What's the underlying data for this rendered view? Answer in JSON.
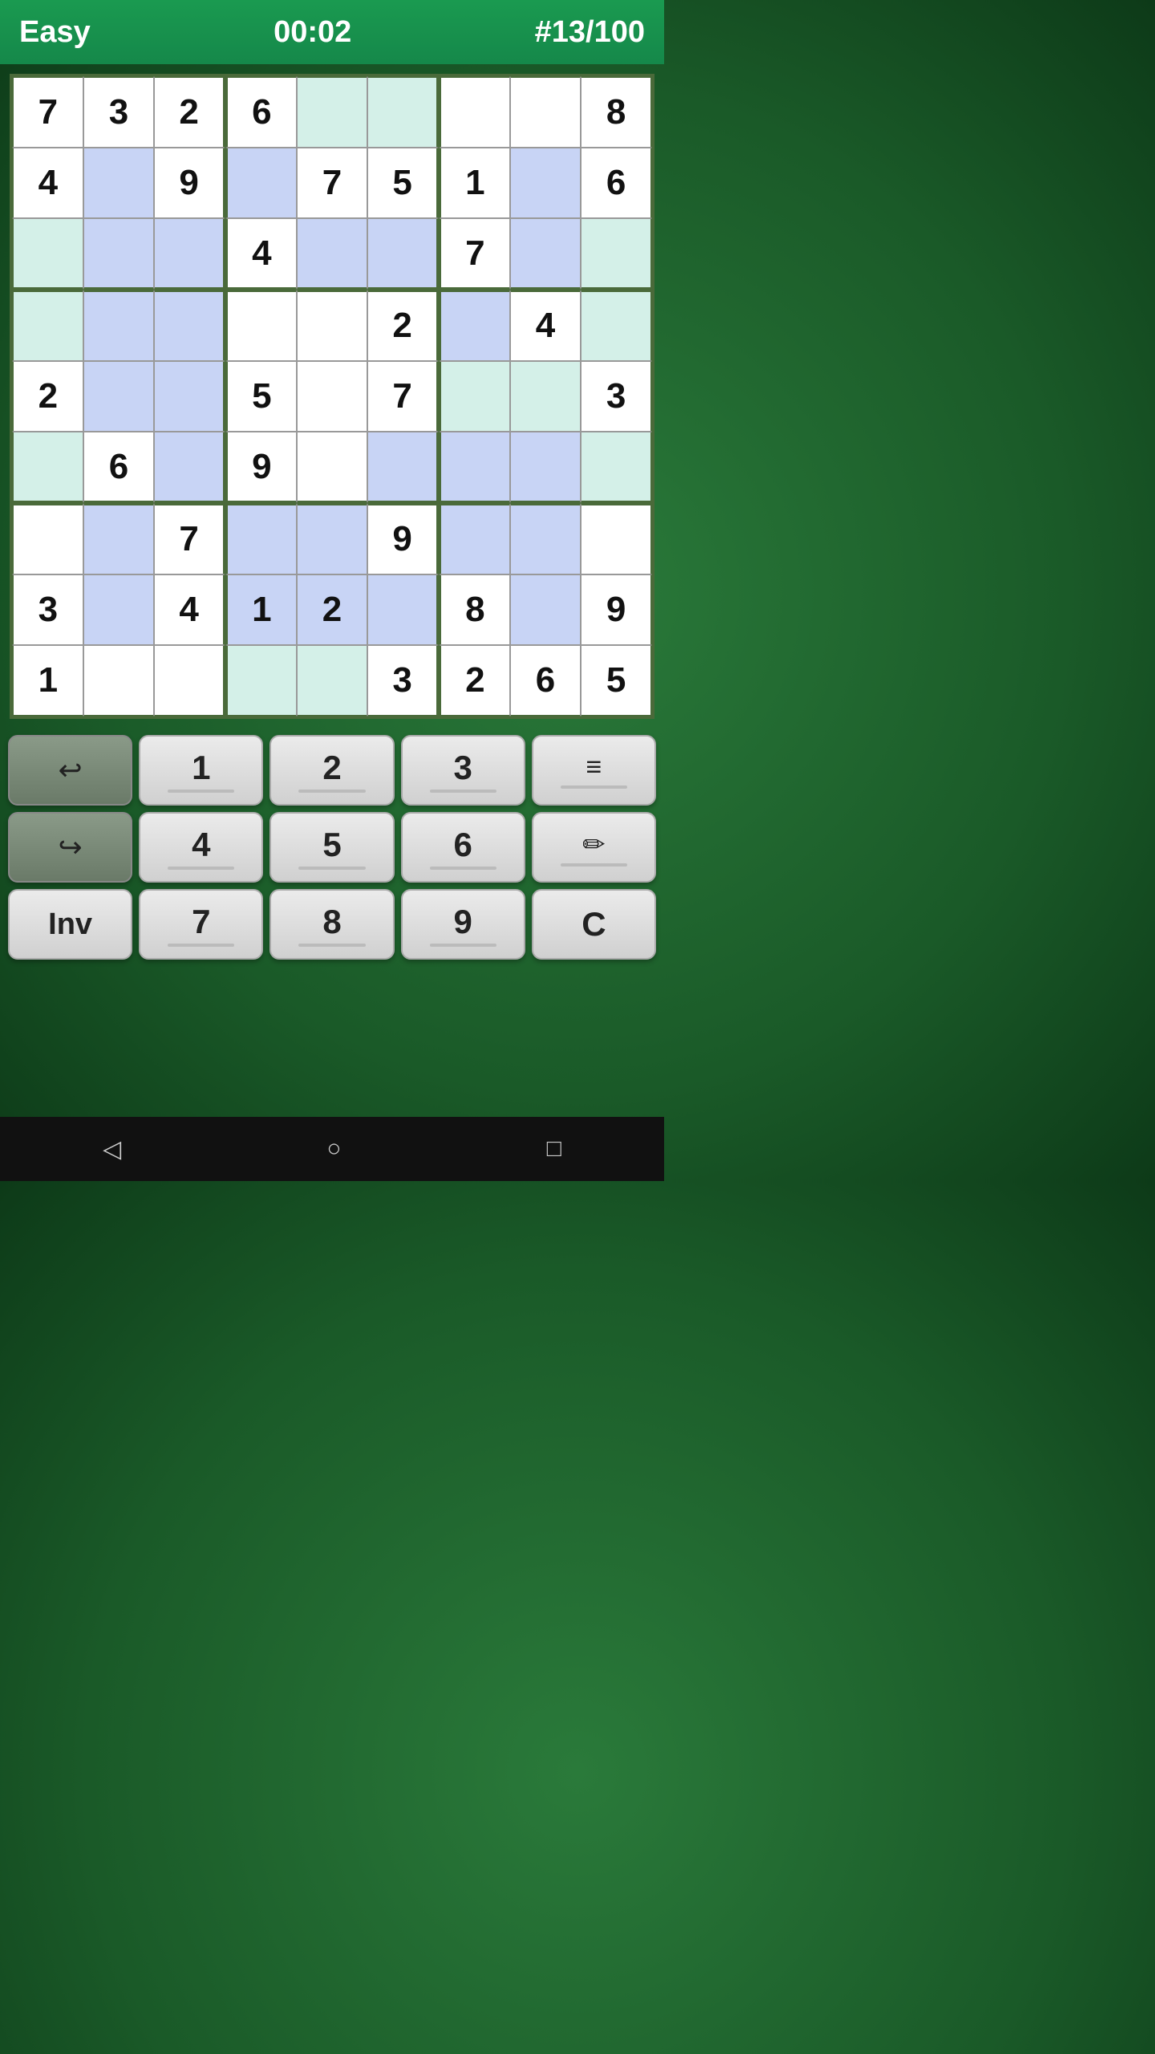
{
  "header": {
    "difficulty": "Easy",
    "timer": "00:02",
    "puzzle_id": "#13/100"
  },
  "grid": {
    "cells": [
      {
        "row": 0,
        "col": 0,
        "value": "7",
        "bg": "white"
      },
      {
        "row": 0,
        "col": 1,
        "value": "3",
        "bg": "white"
      },
      {
        "row": 0,
        "col": 2,
        "value": "2",
        "bg": "white"
      },
      {
        "row": 0,
        "col": 3,
        "value": "6",
        "bg": "white"
      },
      {
        "row": 0,
        "col": 4,
        "value": "",
        "bg": "light-teal"
      },
      {
        "row": 0,
        "col": 5,
        "value": "",
        "bg": "light-teal"
      },
      {
        "row": 0,
        "col": 6,
        "value": "",
        "bg": "white"
      },
      {
        "row": 0,
        "col": 7,
        "value": "",
        "bg": "white"
      },
      {
        "row": 0,
        "col": 8,
        "value": "8",
        "bg": "white"
      },
      {
        "row": 1,
        "col": 0,
        "value": "4",
        "bg": "white"
      },
      {
        "row": 1,
        "col": 1,
        "value": "",
        "bg": "light-blue"
      },
      {
        "row": 1,
        "col": 2,
        "value": "9",
        "bg": "white"
      },
      {
        "row": 1,
        "col": 3,
        "value": "",
        "bg": "light-blue"
      },
      {
        "row": 1,
        "col": 4,
        "value": "7",
        "bg": "white"
      },
      {
        "row": 1,
        "col": 5,
        "value": "5",
        "bg": "white"
      },
      {
        "row": 1,
        "col": 6,
        "value": "1",
        "bg": "white"
      },
      {
        "row": 1,
        "col": 7,
        "value": "",
        "bg": "light-blue"
      },
      {
        "row": 1,
        "col": 8,
        "value": "6",
        "bg": "white"
      },
      {
        "row": 2,
        "col": 0,
        "value": "",
        "bg": "light-teal"
      },
      {
        "row": 2,
        "col": 1,
        "value": "",
        "bg": "light-blue"
      },
      {
        "row": 2,
        "col": 2,
        "value": "",
        "bg": "light-blue"
      },
      {
        "row": 2,
        "col": 3,
        "value": "4",
        "bg": "white"
      },
      {
        "row": 2,
        "col": 4,
        "value": "",
        "bg": "light-blue"
      },
      {
        "row": 2,
        "col": 5,
        "value": "",
        "bg": "light-blue"
      },
      {
        "row": 2,
        "col": 6,
        "value": "7",
        "bg": "white"
      },
      {
        "row": 2,
        "col": 7,
        "value": "",
        "bg": "light-blue"
      },
      {
        "row": 2,
        "col": 8,
        "value": "",
        "bg": "light-teal"
      },
      {
        "row": 3,
        "col": 0,
        "value": "",
        "bg": "light-teal"
      },
      {
        "row": 3,
        "col": 1,
        "value": "",
        "bg": "light-blue"
      },
      {
        "row": 3,
        "col": 2,
        "value": "",
        "bg": "light-blue"
      },
      {
        "row": 3,
        "col": 3,
        "value": "",
        "bg": "white"
      },
      {
        "row": 3,
        "col": 4,
        "value": "",
        "bg": "white"
      },
      {
        "row": 3,
        "col": 5,
        "value": "2",
        "bg": "white"
      },
      {
        "row": 3,
        "col": 6,
        "value": "",
        "bg": "light-blue"
      },
      {
        "row": 3,
        "col": 7,
        "value": "4",
        "bg": "white"
      },
      {
        "row": 3,
        "col": 8,
        "value": "",
        "bg": "light-teal"
      },
      {
        "row": 4,
        "col": 0,
        "value": "2",
        "bg": "white"
      },
      {
        "row": 4,
        "col": 1,
        "value": "",
        "bg": "light-blue"
      },
      {
        "row": 4,
        "col": 2,
        "value": "",
        "bg": "light-blue"
      },
      {
        "row": 4,
        "col": 3,
        "value": "5",
        "bg": "white"
      },
      {
        "row": 4,
        "col": 4,
        "value": "",
        "bg": "white"
      },
      {
        "row": 4,
        "col": 5,
        "value": "7",
        "bg": "white"
      },
      {
        "row": 4,
        "col": 6,
        "value": "",
        "bg": "light-teal"
      },
      {
        "row": 4,
        "col": 7,
        "value": "",
        "bg": "light-teal"
      },
      {
        "row": 4,
        "col": 8,
        "value": "3",
        "bg": "white"
      },
      {
        "row": 5,
        "col": 0,
        "value": "",
        "bg": "light-teal"
      },
      {
        "row": 5,
        "col": 1,
        "value": "6",
        "bg": "white"
      },
      {
        "row": 5,
        "col": 2,
        "value": "",
        "bg": "light-blue"
      },
      {
        "row": 5,
        "col": 3,
        "value": "9",
        "bg": "white"
      },
      {
        "row": 5,
        "col": 4,
        "value": "",
        "bg": "white"
      },
      {
        "row": 5,
        "col": 5,
        "value": "",
        "bg": "light-blue"
      },
      {
        "row": 5,
        "col": 6,
        "value": "",
        "bg": "light-blue"
      },
      {
        "row": 5,
        "col": 7,
        "value": "",
        "bg": "light-blue"
      },
      {
        "row": 5,
        "col": 8,
        "value": "",
        "bg": "light-teal"
      },
      {
        "row": 6,
        "col": 0,
        "value": "",
        "bg": "white"
      },
      {
        "row": 6,
        "col": 1,
        "value": "",
        "bg": "light-blue"
      },
      {
        "row": 6,
        "col": 2,
        "value": "7",
        "bg": "white"
      },
      {
        "row": 6,
        "col": 3,
        "value": "",
        "bg": "light-blue"
      },
      {
        "row": 6,
        "col": 4,
        "value": "",
        "bg": "light-blue"
      },
      {
        "row": 6,
        "col": 5,
        "value": "9",
        "bg": "white"
      },
      {
        "row": 6,
        "col": 6,
        "value": "",
        "bg": "light-blue"
      },
      {
        "row": 6,
        "col": 7,
        "value": "",
        "bg": "light-blue"
      },
      {
        "row": 6,
        "col": 8,
        "value": "",
        "bg": "white"
      },
      {
        "row": 7,
        "col": 0,
        "value": "3",
        "bg": "white"
      },
      {
        "row": 7,
        "col": 1,
        "value": "",
        "bg": "light-blue"
      },
      {
        "row": 7,
        "col": 2,
        "value": "4",
        "bg": "white"
      },
      {
        "row": 7,
        "col": 3,
        "value": "1",
        "bg": "light-blue"
      },
      {
        "row": 7,
        "col": 4,
        "value": "2",
        "bg": "light-blue"
      },
      {
        "row": 7,
        "col": 5,
        "value": "",
        "bg": "light-blue"
      },
      {
        "row": 7,
        "col": 6,
        "value": "8",
        "bg": "white"
      },
      {
        "row": 7,
        "col": 7,
        "value": "",
        "bg": "light-blue"
      },
      {
        "row": 7,
        "col": 8,
        "value": "9",
        "bg": "white"
      },
      {
        "row": 8,
        "col": 0,
        "value": "1",
        "bg": "white"
      },
      {
        "row": 8,
        "col": 1,
        "value": "",
        "bg": "white"
      },
      {
        "row": 8,
        "col": 2,
        "value": "",
        "bg": "white"
      },
      {
        "row": 8,
        "col": 3,
        "value": "",
        "bg": "light-teal"
      },
      {
        "row": 8,
        "col": 4,
        "value": "",
        "bg": "light-teal"
      },
      {
        "row": 8,
        "col": 5,
        "value": "3",
        "bg": "white"
      },
      {
        "row": 8,
        "col": 6,
        "value": "2",
        "bg": "white"
      },
      {
        "row": 8,
        "col": 7,
        "value": "6",
        "bg": "white"
      },
      {
        "row": 8,
        "col": 8,
        "value": "5",
        "bg": "white"
      }
    ]
  },
  "keyboard": {
    "row1": [
      {
        "label": "",
        "type": "undo",
        "icon": "↩"
      },
      {
        "label": "1",
        "type": "number"
      },
      {
        "label": "2",
        "type": "number"
      },
      {
        "label": "3",
        "type": "number"
      },
      {
        "label": "≡",
        "type": "menu",
        "icon": "≡"
      }
    ],
    "row2": [
      {
        "label": "",
        "type": "redo",
        "icon": "↪"
      },
      {
        "label": "4",
        "type": "number"
      },
      {
        "label": "5",
        "type": "number"
      },
      {
        "label": "6",
        "type": "number"
      },
      {
        "label": "✏",
        "type": "pencil",
        "icon": "✏"
      }
    ],
    "row3": [
      {
        "label": "Inv",
        "type": "inv"
      },
      {
        "label": "7",
        "type": "number"
      },
      {
        "label": "8",
        "type": "number"
      },
      {
        "label": "9",
        "type": "number"
      },
      {
        "label": "C",
        "type": "clear"
      }
    ]
  },
  "nav": {
    "back": "◁",
    "home": "○",
    "recent": "□"
  }
}
